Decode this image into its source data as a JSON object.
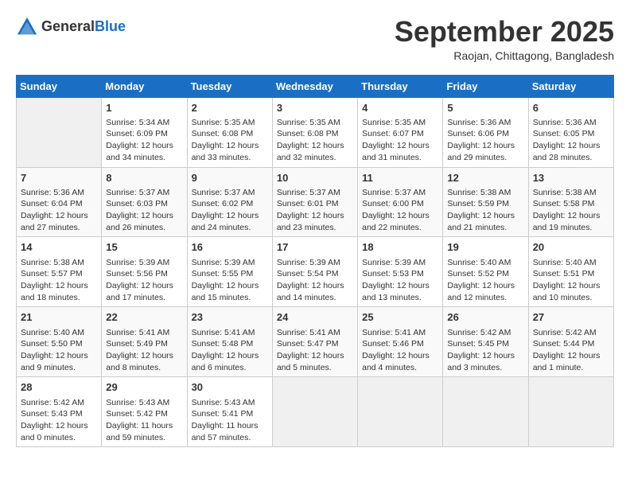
{
  "logo": {
    "general": "General",
    "blue": "Blue"
  },
  "header": {
    "month": "September 2025",
    "location": "Raojan, Chittagong, Bangladesh"
  },
  "days_header": [
    "Sunday",
    "Monday",
    "Tuesday",
    "Wednesday",
    "Thursday",
    "Friday",
    "Saturday"
  ],
  "weeks": [
    [
      {
        "day": "",
        "info": ""
      },
      {
        "day": "1",
        "info": "Sunrise: 5:34 AM\nSunset: 6:09 PM\nDaylight: 12 hours\nand 34 minutes."
      },
      {
        "day": "2",
        "info": "Sunrise: 5:35 AM\nSunset: 6:08 PM\nDaylight: 12 hours\nand 33 minutes."
      },
      {
        "day": "3",
        "info": "Sunrise: 5:35 AM\nSunset: 6:08 PM\nDaylight: 12 hours\nand 32 minutes."
      },
      {
        "day": "4",
        "info": "Sunrise: 5:35 AM\nSunset: 6:07 PM\nDaylight: 12 hours\nand 31 minutes."
      },
      {
        "day": "5",
        "info": "Sunrise: 5:36 AM\nSunset: 6:06 PM\nDaylight: 12 hours\nand 29 minutes."
      },
      {
        "day": "6",
        "info": "Sunrise: 5:36 AM\nSunset: 6:05 PM\nDaylight: 12 hours\nand 28 minutes."
      }
    ],
    [
      {
        "day": "7",
        "info": "Sunrise: 5:36 AM\nSunset: 6:04 PM\nDaylight: 12 hours\nand 27 minutes."
      },
      {
        "day": "8",
        "info": "Sunrise: 5:37 AM\nSunset: 6:03 PM\nDaylight: 12 hours\nand 26 minutes."
      },
      {
        "day": "9",
        "info": "Sunrise: 5:37 AM\nSunset: 6:02 PM\nDaylight: 12 hours\nand 24 minutes."
      },
      {
        "day": "10",
        "info": "Sunrise: 5:37 AM\nSunset: 6:01 PM\nDaylight: 12 hours\nand 23 minutes."
      },
      {
        "day": "11",
        "info": "Sunrise: 5:37 AM\nSunset: 6:00 PM\nDaylight: 12 hours\nand 22 minutes."
      },
      {
        "day": "12",
        "info": "Sunrise: 5:38 AM\nSunset: 5:59 PM\nDaylight: 12 hours\nand 21 minutes."
      },
      {
        "day": "13",
        "info": "Sunrise: 5:38 AM\nSunset: 5:58 PM\nDaylight: 12 hours\nand 19 minutes."
      }
    ],
    [
      {
        "day": "14",
        "info": "Sunrise: 5:38 AM\nSunset: 5:57 PM\nDaylight: 12 hours\nand 18 minutes."
      },
      {
        "day": "15",
        "info": "Sunrise: 5:39 AM\nSunset: 5:56 PM\nDaylight: 12 hours\nand 17 minutes."
      },
      {
        "day": "16",
        "info": "Sunrise: 5:39 AM\nSunset: 5:55 PM\nDaylight: 12 hours\nand 15 minutes."
      },
      {
        "day": "17",
        "info": "Sunrise: 5:39 AM\nSunset: 5:54 PM\nDaylight: 12 hours\nand 14 minutes."
      },
      {
        "day": "18",
        "info": "Sunrise: 5:39 AM\nSunset: 5:53 PM\nDaylight: 12 hours\nand 13 minutes."
      },
      {
        "day": "19",
        "info": "Sunrise: 5:40 AM\nSunset: 5:52 PM\nDaylight: 12 hours\nand 12 minutes."
      },
      {
        "day": "20",
        "info": "Sunrise: 5:40 AM\nSunset: 5:51 PM\nDaylight: 12 hours\nand 10 minutes."
      }
    ],
    [
      {
        "day": "21",
        "info": "Sunrise: 5:40 AM\nSunset: 5:50 PM\nDaylight: 12 hours\nand 9 minutes."
      },
      {
        "day": "22",
        "info": "Sunrise: 5:41 AM\nSunset: 5:49 PM\nDaylight: 12 hours\nand 8 minutes."
      },
      {
        "day": "23",
        "info": "Sunrise: 5:41 AM\nSunset: 5:48 PM\nDaylight: 12 hours\nand 6 minutes."
      },
      {
        "day": "24",
        "info": "Sunrise: 5:41 AM\nSunset: 5:47 PM\nDaylight: 12 hours\nand 5 minutes."
      },
      {
        "day": "25",
        "info": "Sunrise: 5:41 AM\nSunset: 5:46 PM\nDaylight: 12 hours\nand 4 minutes."
      },
      {
        "day": "26",
        "info": "Sunrise: 5:42 AM\nSunset: 5:45 PM\nDaylight: 12 hours\nand 3 minutes."
      },
      {
        "day": "27",
        "info": "Sunrise: 5:42 AM\nSunset: 5:44 PM\nDaylight: 12 hours\nand 1 minute."
      }
    ],
    [
      {
        "day": "28",
        "info": "Sunrise: 5:42 AM\nSunset: 5:43 PM\nDaylight: 12 hours\nand 0 minutes."
      },
      {
        "day": "29",
        "info": "Sunrise: 5:43 AM\nSunset: 5:42 PM\nDaylight: 11 hours\nand 59 minutes."
      },
      {
        "day": "30",
        "info": "Sunrise: 5:43 AM\nSunset: 5:41 PM\nDaylight: 11 hours\nand 57 minutes."
      },
      {
        "day": "",
        "info": ""
      },
      {
        "day": "",
        "info": ""
      },
      {
        "day": "",
        "info": ""
      },
      {
        "day": "",
        "info": ""
      }
    ]
  ]
}
